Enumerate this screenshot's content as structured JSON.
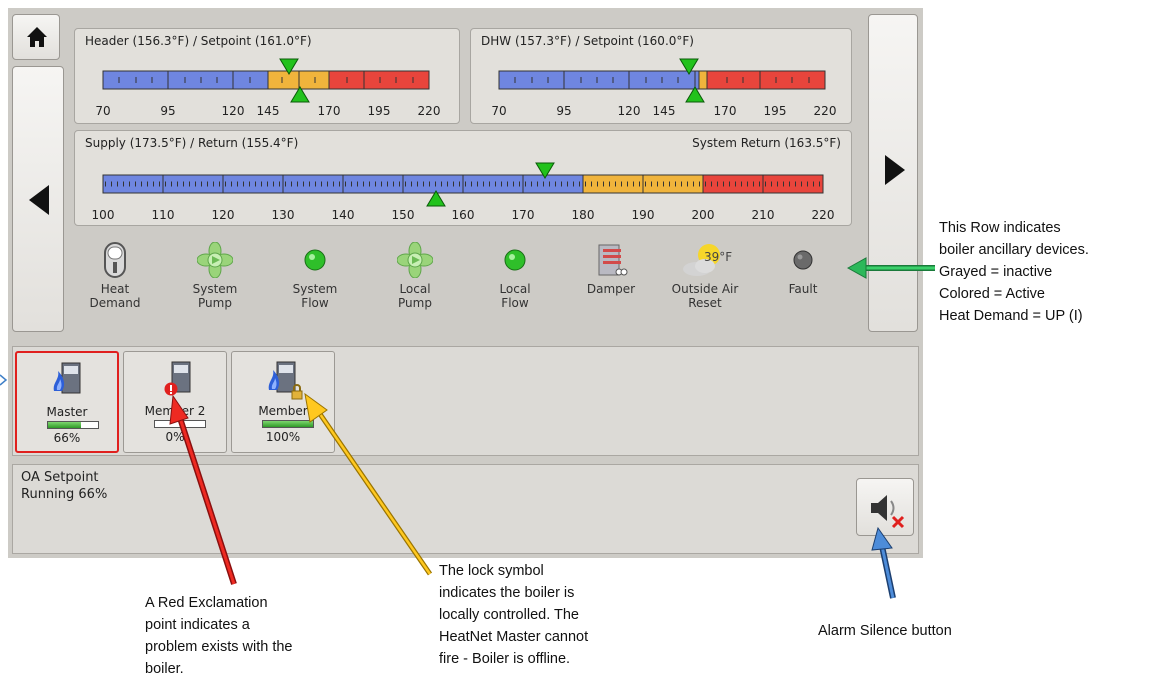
{
  "gauges": {
    "header": {
      "title": "Header (156.3°F) / Setpoint (161.0°F)",
      "ticks": [
        "70",
        "95",
        "120",
        "145",
        "170",
        "195",
        "220"
      ]
    },
    "dhw": {
      "title": "DHW (157.3°F) / Setpoint (160.0°F)",
      "ticks": [
        "70",
        "95",
        "120",
        "145",
        "170",
        "195",
        "220"
      ]
    },
    "supply": {
      "title": "Supply (173.5°F) / Return (155.4°F)",
      "right_title": "System Return (163.5°F)",
      "ticks": [
        "100",
        "110",
        "120",
        "130",
        "140",
        "150",
        "160",
        "170",
        "180",
        "190",
        "200",
        "210",
        "220"
      ]
    }
  },
  "devices": [
    {
      "label": "Heat\nDemand",
      "icon": "toggle-switch-icon"
    },
    {
      "label": "System\nPump",
      "icon": "pump-icon"
    },
    {
      "label": "System\nFlow",
      "icon": "flow-led-icon"
    },
    {
      "label": "Local\nPump",
      "icon": "pump-icon"
    },
    {
      "label": "Local\nFlow",
      "icon": "flow-led-icon"
    },
    {
      "label": "Damper",
      "icon": "damper-icon"
    },
    {
      "label": "Outside Air\nReset",
      "icon": "outside-air-icon",
      "badge": "39°F"
    },
    {
      "label": "Fault",
      "icon": "fault-led-icon"
    }
  ],
  "boilers": [
    {
      "name": "Master",
      "percent": "66%",
      "level": 0.66,
      "selected": true
    },
    {
      "name": "Member 2",
      "percent": "0%",
      "level": 0,
      "alert": true
    },
    {
      "name": "Member",
      "percent": "100%",
      "level": 1.0,
      "locked": true
    }
  ],
  "status": {
    "line1": "OA Setpoint",
    "line2": "Running 66%"
  },
  "annotations": {
    "row_note": [
      "This Row indicates",
      "boiler ancillary devices.",
      "Grayed = inactive",
      "Colored = Active",
      "Heat Demand = UP (I)"
    ],
    "exclamation_note": [
      "A Red Exclamation",
      "point indicates a",
      "problem exists with the",
      "boiler."
    ],
    "lock_note": [
      "The lock symbol",
      "indicates the boiler is",
      "locally controlled. The",
      "HeatNet Master cannot",
      "fire - Boiler is offline."
    ],
    "silence_note": "Alarm Silence button"
  },
  "colors": {
    "cold": "#6f86e0",
    "warm": "#f0b43c",
    "hot": "#e8453c",
    "marker": "#22c21c",
    "green_arrow": "#1aa84a",
    "red_arrow": "#e0201e",
    "yellow_arrow": "#f0b400",
    "blue_arrow": "#3f7fc7"
  }
}
